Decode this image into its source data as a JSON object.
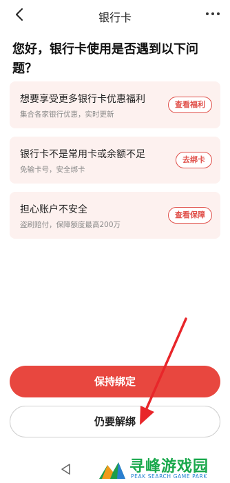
{
  "header": {
    "title": "银行卡",
    "back_icon": "back-chevron-icon",
    "more_icon": "more-dots-icon"
  },
  "question": "您好，银行卡使用是否遇到以下问题？",
  "cards": [
    {
      "title": "想要享受更多银行卡优惠福利",
      "subtitle": "集合各家银行优惠，实时更新",
      "button": "查看福利"
    },
    {
      "title": "银行卡不是常用卡或余额不足",
      "subtitle": "免输卡号，安全绑卡",
      "button": "去绑卡"
    },
    {
      "title": "担心账户不安全",
      "subtitle": "盗刷赔付，保障额度最高200万",
      "button": "查看保障"
    }
  ],
  "actions": {
    "keep_label": "保持绑定",
    "unbind_label": "仍要解绑"
  },
  "watermark": {
    "text": "寻峰游戏园",
    "sub": "PEAK SEARCH GAME PARK"
  },
  "colors": {
    "accent": "#e8473f",
    "card_bg": "#fdf1ef",
    "watermark_green": "#18a84b",
    "watermark_blue": "#1f7fd0"
  }
}
